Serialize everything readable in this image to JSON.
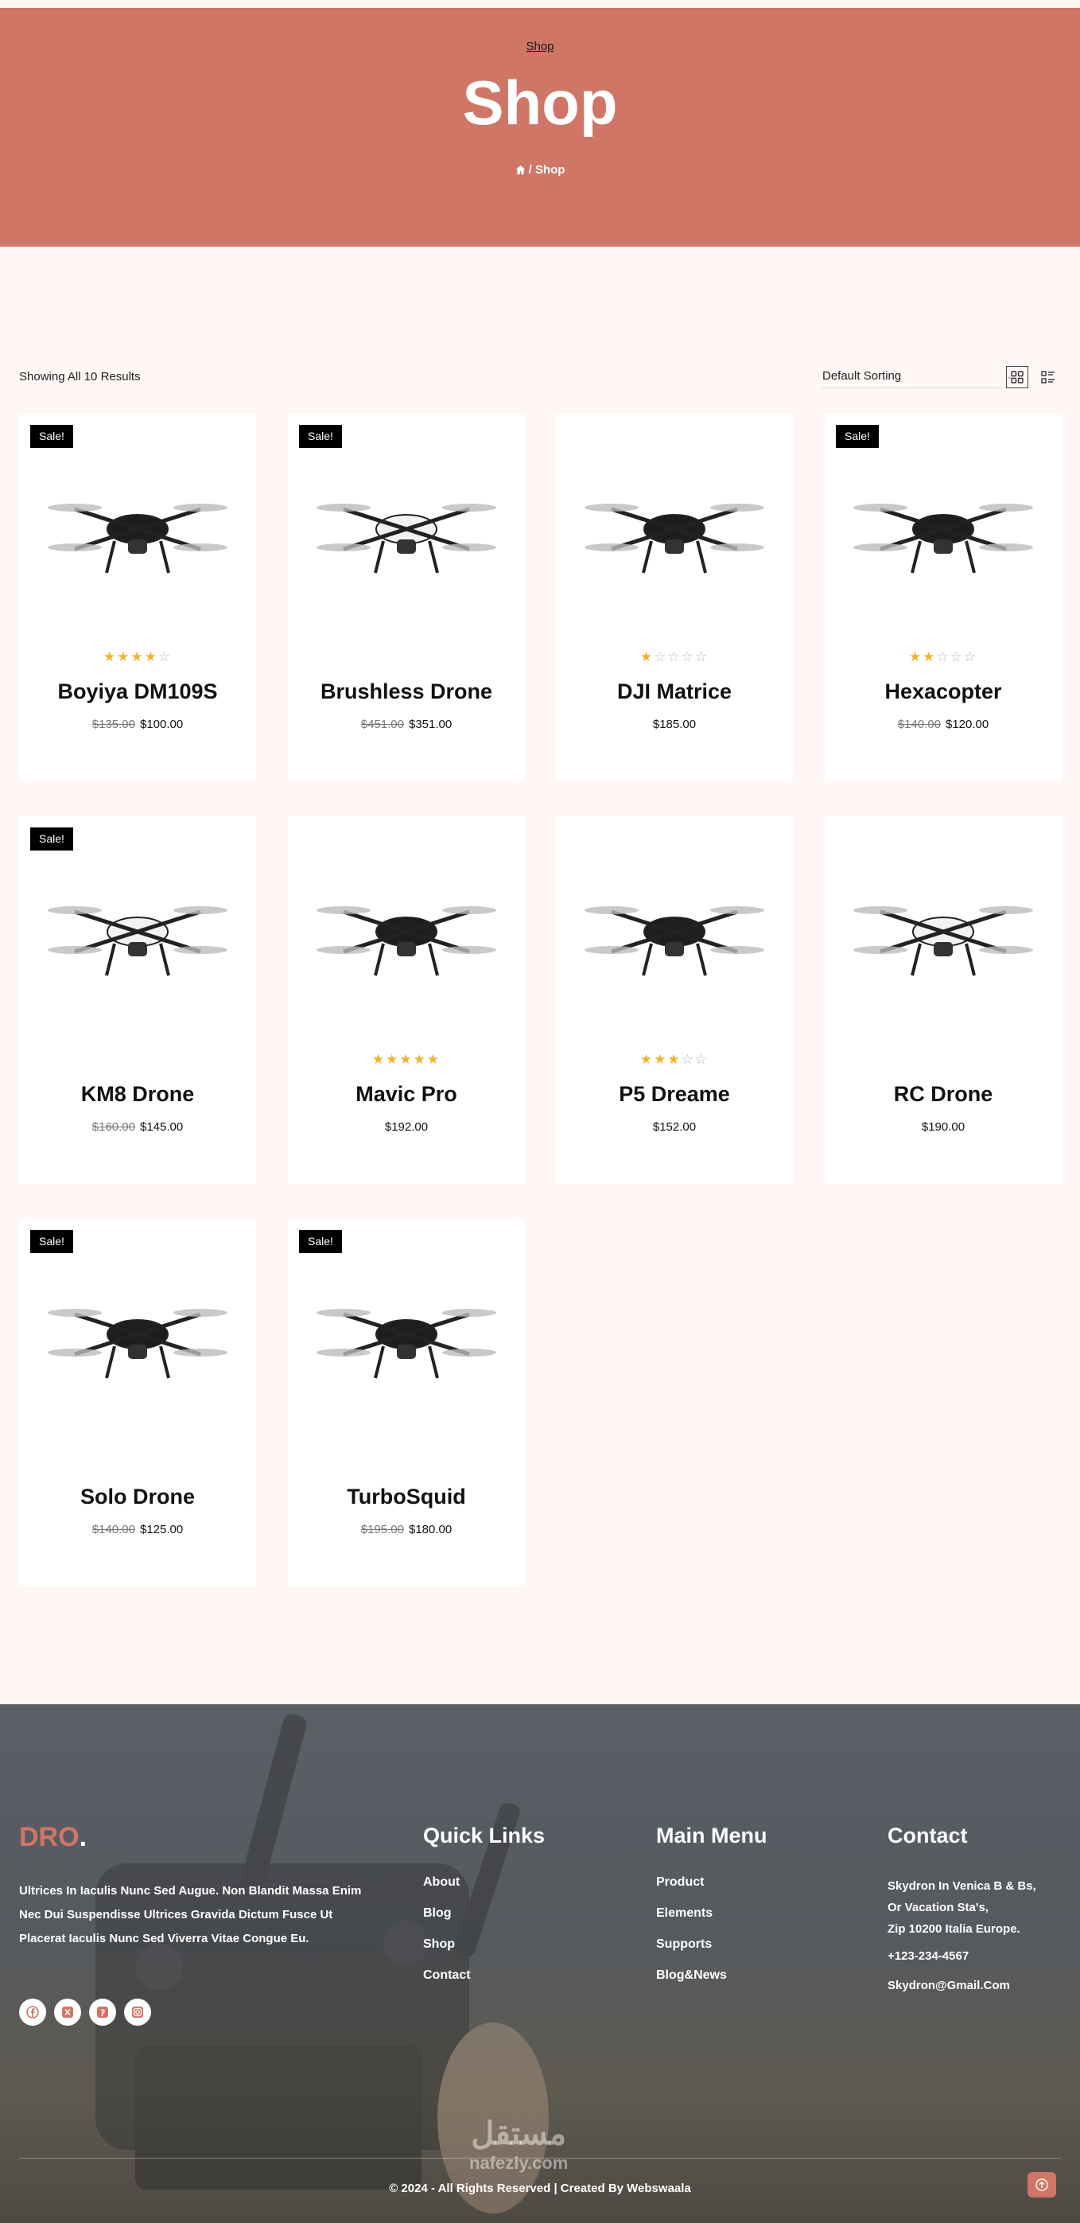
{
  "hero": {
    "top_link": "Shop",
    "title": "Shop",
    "breadcrumb_current": "/ Shop"
  },
  "toolbar": {
    "result_count": "Showing All 10 Results",
    "sort_selected": "Default Sorting"
  },
  "products": [
    {
      "name": "Boyiya DM109S",
      "sale": "Sale!",
      "rating": 4,
      "old_price": "$135.00",
      "price": "$100.00"
    },
    {
      "name": "Brushless Drone",
      "sale": "Sale!",
      "rating": 0,
      "old_price": "$451.00",
      "price": "$351.00"
    },
    {
      "name": "DJI Matrice",
      "sale": "",
      "rating": 1,
      "old_price": "",
      "price": "$185.00"
    },
    {
      "name": "Hexacopter",
      "sale": "Sale!",
      "rating": 2,
      "old_price": "$140.00",
      "price": "$120.00"
    },
    {
      "name": "KM8 Drone",
      "sale": "Sale!",
      "rating": 0,
      "old_price": "$160.00",
      "price": "$145.00"
    },
    {
      "name": "Mavic Pro",
      "sale": "",
      "rating": 5,
      "old_price": "",
      "price": "$192.00"
    },
    {
      "name": "P5 Dreame",
      "sale": "",
      "rating": 3,
      "old_price": "",
      "price": "$152.00"
    },
    {
      "name": "RC Drone",
      "sale": "",
      "rating": 0,
      "old_price": "",
      "price": "$190.00"
    },
    {
      "name": "Solo Drone",
      "sale": "Sale!",
      "rating": 0,
      "old_price": "$140.00",
      "price": "$125.00"
    },
    {
      "name": "TurboSquid",
      "sale": "Sale!",
      "rating": 0,
      "old_price": "$195.00",
      "price": "$180.00"
    }
  ],
  "footer": {
    "logo": "DRO",
    "logo_dot": ".",
    "about": "Ultrices In Iaculis Nunc Sed Augue. Non Blandit Massa Enim Nec Dui Suspendisse Ultrices Gravida Dictum Fusce Ut Placerat Iaculis Nunc Sed Viverra Vitae Congue Eu.",
    "quick_links": {
      "title": "Quick Links",
      "items": [
        "About",
        "Blog",
        "Shop",
        "Contact"
      ]
    },
    "main_menu": {
      "title": "Main Menu",
      "items": [
        "Product",
        "Elements",
        "Supports",
        "Blog&News"
      ]
    },
    "contact": {
      "title": "Contact",
      "address_1": "Skydron In Venica B & Bs,",
      "address_2": "Or Vacation Sta's,",
      "address_3": "Zip 10200 Italia Europe.",
      "phone": "+123-234-4567",
      "email": "Skydron@Gmail.Com"
    },
    "copyright": "© 2024 - All Rights Reserved | Created By Webswaala",
    "watermark": "مستقل",
    "watermark_2": "nafezly.com"
  },
  "colors": {
    "accent": "#cf7666",
    "star": "#f0b429",
    "sale_badge": "#000000"
  },
  "icons": [
    "home-icon",
    "grid-view-icon",
    "list-view-icon",
    "facebook-icon",
    "x-icon",
    "pinterest-icon",
    "instagram-icon",
    "arrow-up-icon"
  ]
}
